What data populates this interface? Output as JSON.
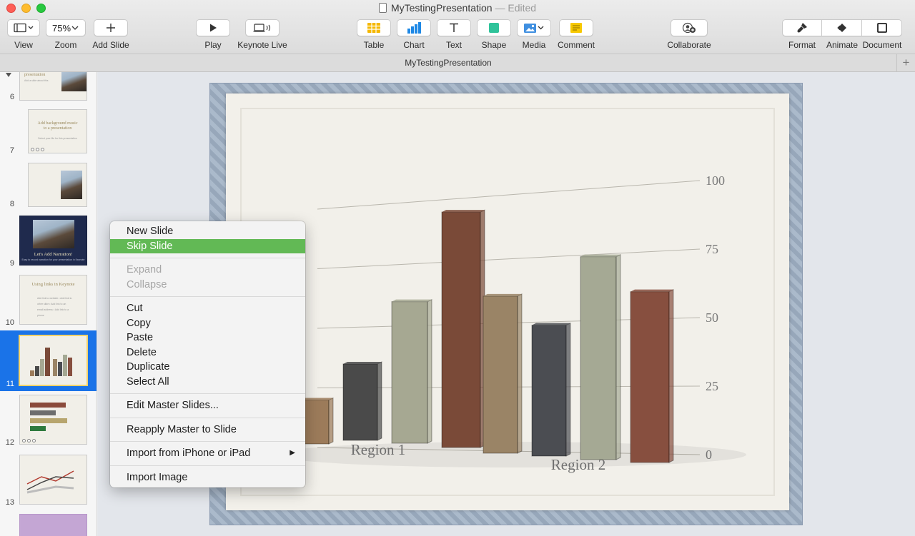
{
  "window": {
    "title": "MyTestingPresentation",
    "status": "— Edited"
  },
  "toolbar": {
    "view": "View",
    "zoom": "Zoom",
    "zoom_value": "75%",
    "add_slide": "Add Slide",
    "play": "Play",
    "keynote_live": "Keynote Live",
    "table": "Table",
    "chart": "Chart",
    "text": "Text",
    "shape": "Shape",
    "media": "Media",
    "comment": "Comment",
    "collaborate": "Collaborate",
    "format": "Format",
    "animate": "Animate",
    "document": "Document"
  },
  "tabbar": {
    "title": "MyTestingPresentation",
    "add": "+"
  },
  "navigator": {
    "slides": [
      {
        "number": "6",
        "title": "presentation",
        "subtitle": "Add a slide about this"
      },
      {
        "number": "7",
        "title": "Add background music to a presentation",
        "subtitle": "Select your file for this presentation"
      },
      {
        "number": "8",
        "title": "",
        "subtitle": ""
      },
      {
        "number": "9",
        "title": "Let's Add Narration!",
        "subtitle": "Easy to record narration for your presentation in Keynote"
      },
      {
        "number": "10",
        "title": "Using links in Keynote",
        "subtitle": "Add link to website • Add link to other slide • Add link to an email address • Add link to a phone"
      },
      {
        "number": "11",
        "title": "",
        "subtitle": ""
      },
      {
        "number": "12",
        "title": "",
        "subtitle": ""
      },
      {
        "number": "13",
        "title": "",
        "subtitle": ""
      }
    ]
  },
  "context_menu": {
    "new_slide": "New Slide",
    "skip_slide": "Skip Slide",
    "expand": "Expand",
    "collapse": "Collapse",
    "cut": "Cut",
    "copy": "Copy",
    "paste": "Paste",
    "delete": "Delete",
    "duplicate": "Duplicate",
    "select_all": "Select All",
    "edit_master": "Edit Master Slides...",
    "reapply_master": "Reapply Master to Slide",
    "import_iphone": "Import from iPhone or iPad",
    "import_image": "Import Image"
  },
  "colors": {
    "highlight": "#62b955",
    "selection": "#1a73e8"
  },
  "chart_data": {
    "type": "bar",
    "categories": [
      "Region 1",
      "Region 2"
    ],
    "series": [
      {
        "values": [
          17,
          57
        ]
      },
      {
        "values": [
          30,
          47
        ]
      },
      {
        "values": [
          55,
          72
        ]
      },
      {
        "values": [
          90,
          60
        ]
      }
    ],
    "y_ticks": [
      "0",
      "25",
      "50",
      "75",
      "100"
    ],
    "ylim": [
      0,
      100
    ],
    "series_colors": [
      "#9c7b5a",
      "#4a4a4a",
      "#a6a892",
      "#7a4a38"
    ],
    "region2_colors": [
      "#9a8466",
      "#4b4d52",
      "#a5a994",
      "#874f3f"
    ]
  }
}
